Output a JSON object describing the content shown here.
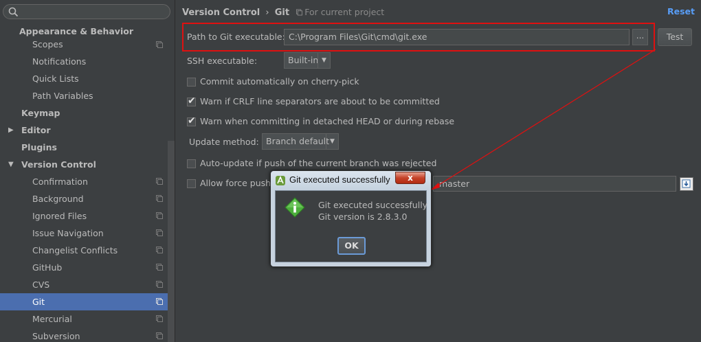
{
  "search": {
    "value": ""
  },
  "sidebar": {
    "items": [
      {
        "label": "Appearance & Behavior"
      },
      {
        "label": "Scopes"
      },
      {
        "label": "Notifications"
      },
      {
        "label": "Quick Lists"
      },
      {
        "label": "Path Variables"
      },
      {
        "label": "Keymap"
      },
      {
        "label": "Editor"
      },
      {
        "label": "Plugins"
      },
      {
        "label": "Version Control"
      },
      {
        "label": "Confirmation"
      },
      {
        "label": "Background"
      },
      {
        "label": "Ignored Files"
      },
      {
        "label": "Issue Navigation"
      },
      {
        "label": "Changelist Conflicts"
      },
      {
        "label": "GitHub"
      },
      {
        "label": "CVS"
      },
      {
        "label": "Git"
      },
      {
        "label": "Mercurial"
      },
      {
        "label": "Subversion"
      }
    ]
  },
  "header": {
    "crumb1": "Version Control",
    "separator": "›",
    "crumb2": "Git",
    "scope": "For current project",
    "reset": "Reset"
  },
  "settings": {
    "path_label": "Path to Git executable:",
    "path_value": "C:\\Program Files\\Git\\cmd\\git.exe",
    "browse_label": "...",
    "test_label": "Test",
    "ssh_label": "SSH executable:",
    "ssh_value": "Built-in",
    "commit_cherry": "Commit automatically on cherry-pick",
    "warn_crlf": "Warn if CRLF line separators are about to be committed",
    "warn_detached": "Warn when committing in detached HEAD or during rebase",
    "update_label": "Update method:",
    "update_value": "Branch default",
    "auto_update": "Auto-update if push of the current branch was rejected",
    "allow_force": "Allow force push",
    "protected_branches": "master"
  },
  "dialog": {
    "title": "Git executed successfully",
    "close": "x",
    "line1": "Git executed successfully",
    "line2": "Git version is 2.8.3.0",
    "ok": "OK"
  },
  "colors": {
    "accent": "#589df6",
    "selection": "#4b6eaf",
    "annotation": "#e01010"
  }
}
